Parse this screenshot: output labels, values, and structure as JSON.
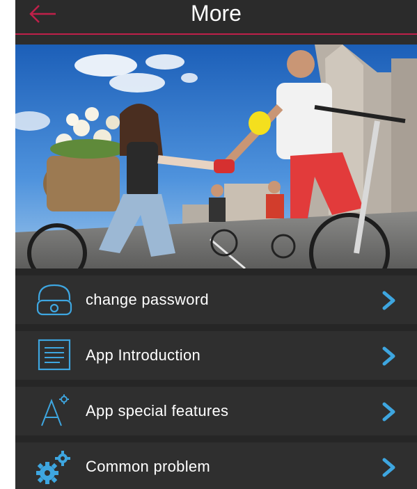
{
  "header": {
    "title": "More",
    "accent_color": "#c0204a",
    "back_icon": "arrow-left-icon"
  },
  "banner": {
    "description_icon": "cyclists-photo"
  },
  "menu": {
    "items": [
      {
        "label": "change password",
        "icon": "lock-icon"
      },
      {
        "label": "App Introduction",
        "icon": "document-icon"
      },
      {
        "label": "App special features",
        "icon": "font-settings-icon"
      },
      {
        "label": "Common problem",
        "icon": "gears-icon"
      }
    ],
    "icon_color": "#3ea6e0",
    "chevron_icon": "chevron-right-icon"
  }
}
